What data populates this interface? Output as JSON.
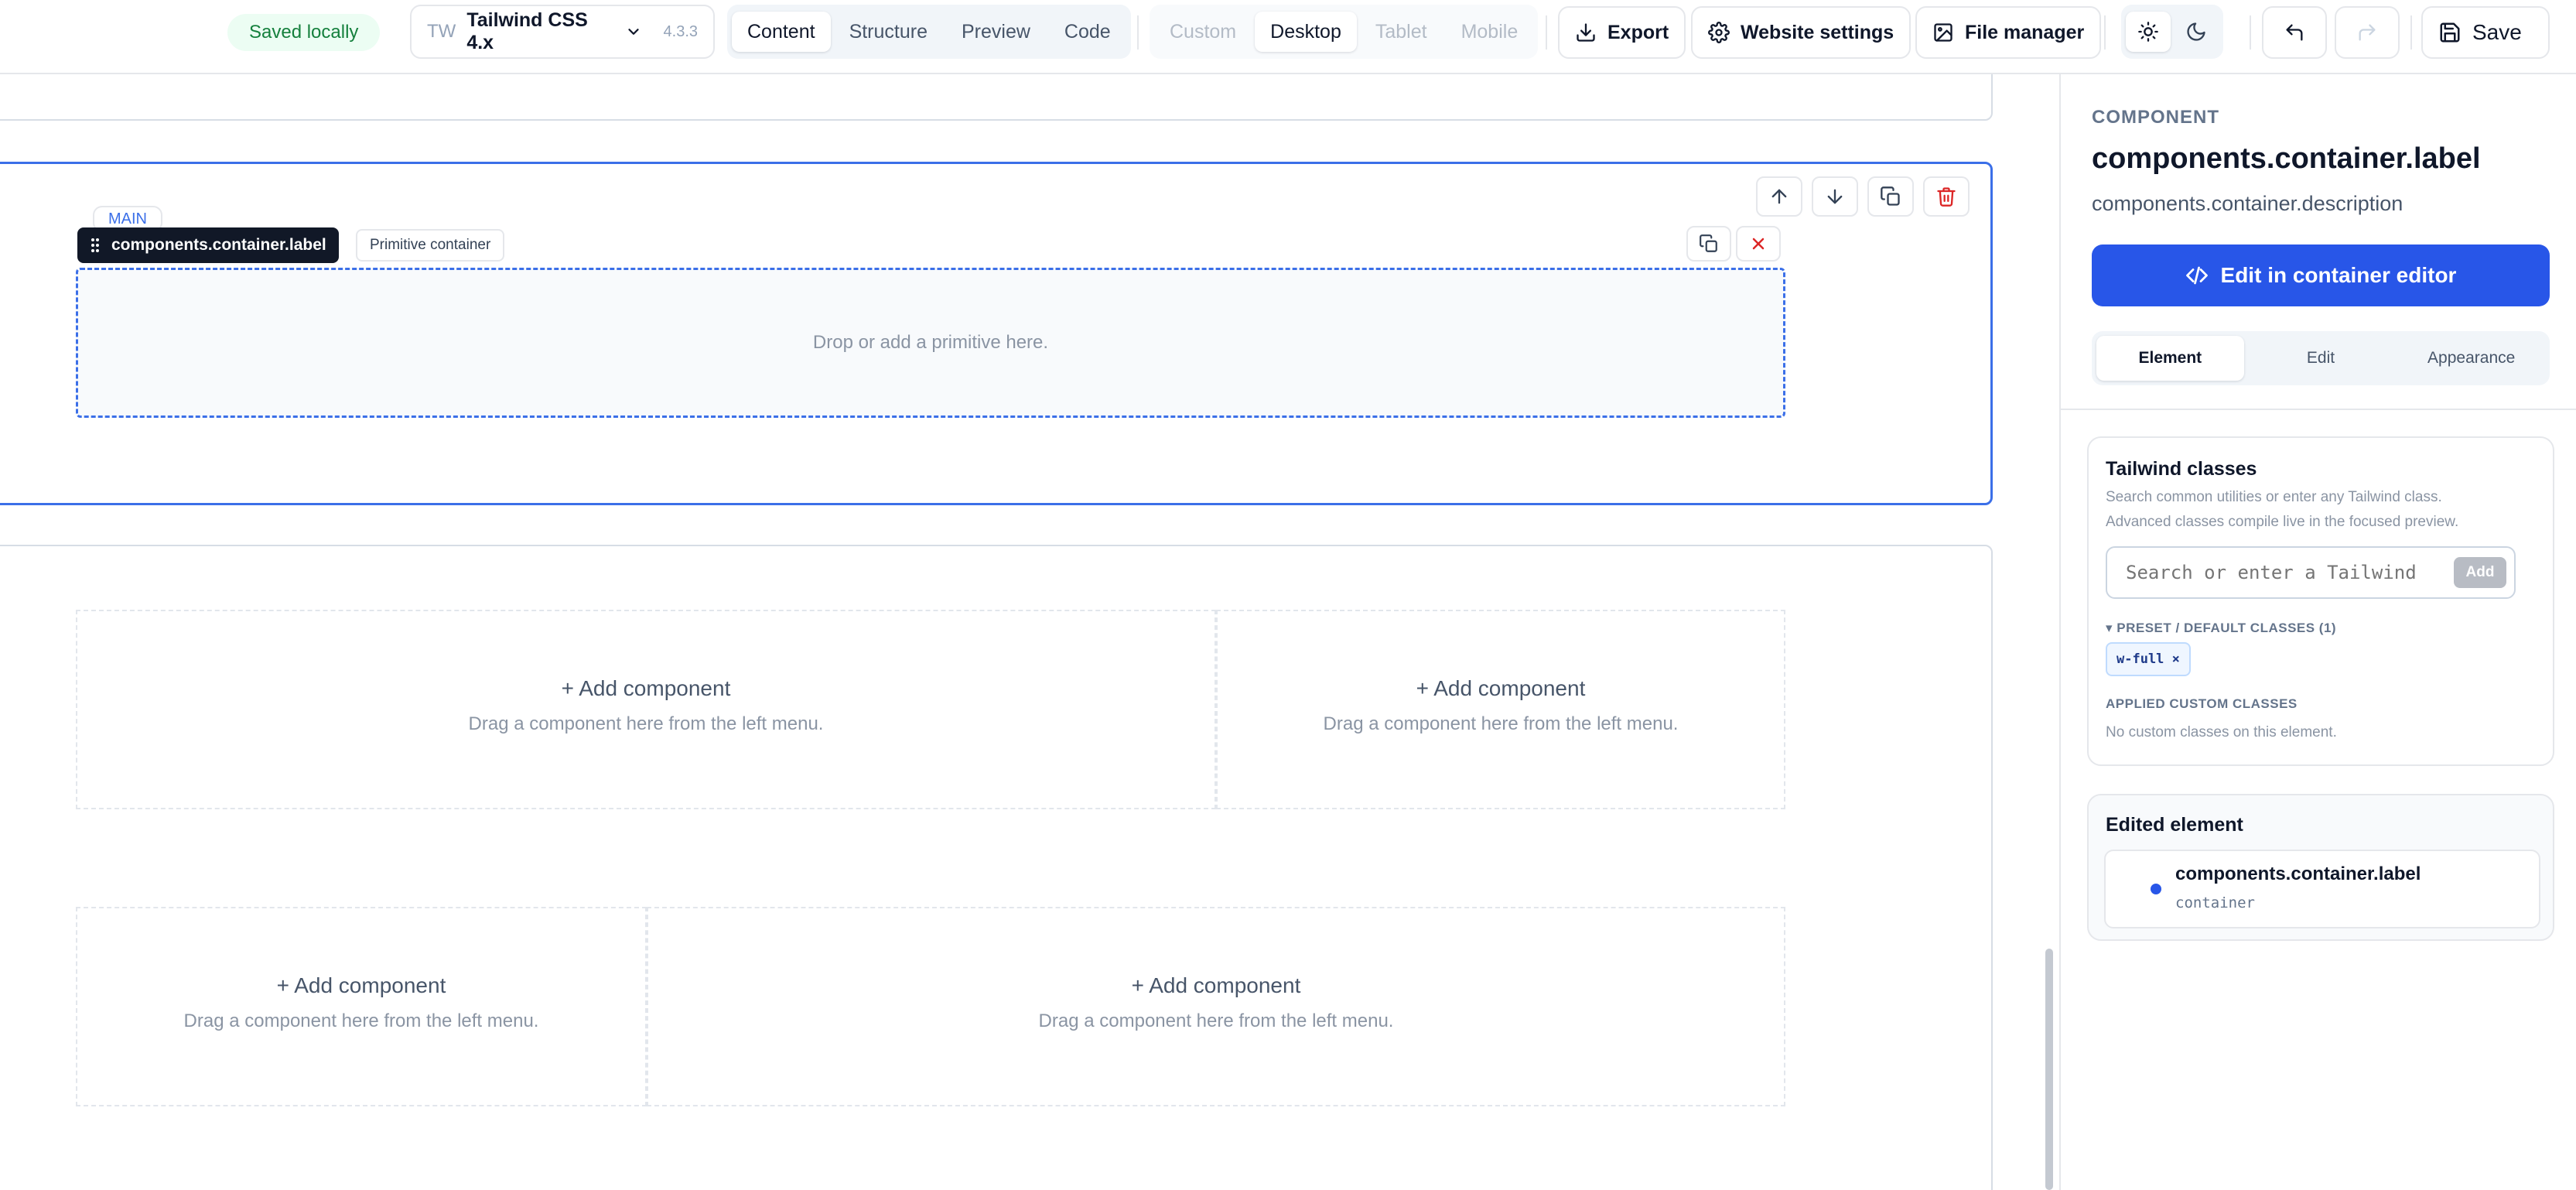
{
  "toolbar": {
    "saved_status": "Saved locally",
    "framework_prefix": "TW",
    "framework_name": "Tailwind CSS 4.x",
    "framework_version": "4.3.3",
    "view_tabs": [
      {
        "label": "Content",
        "active": true
      },
      {
        "label": "Structure",
        "active": false
      },
      {
        "label": "Preview",
        "active": false
      },
      {
        "label": "Code",
        "active": false
      }
    ],
    "device_tabs": [
      {
        "label": "Custom",
        "active": false,
        "disabled": true
      },
      {
        "label": "Desktop",
        "active": true,
        "disabled": false
      },
      {
        "label": "Tablet",
        "active": false,
        "disabled": true
      },
      {
        "label": "Mobile",
        "active": false,
        "disabled": true
      }
    ],
    "export_label": "Export",
    "website_settings_label": "Website settings",
    "file_manager_label": "File manager",
    "save_label": "Save",
    "theme_active": "light"
  },
  "canvas": {
    "section_tag": "MAIN",
    "container_label": "components.container.label",
    "container_type_badge": "Primitive container",
    "drop_hint": "Drop or add a primitive here.",
    "add_component_title": "+ Add component",
    "add_component_hint": "Drag a component here from the left menu."
  },
  "panel": {
    "eyebrow": "COMPONENT",
    "title": "components.container.label",
    "description": "components.container.description",
    "edit_button_label": "Edit in container editor",
    "tabs": [
      {
        "label": "Element",
        "active": true
      },
      {
        "label": "Edit",
        "active": false
      },
      {
        "label": "Appearance",
        "active": false
      }
    ],
    "tailwind": {
      "heading": "Tailwind classes",
      "help_line1": "Search common utilities or enter any Tailwind class.",
      "help_line2": "Advanced classes compile live in the focused preview.",
      "search_placeholder": "Search or enter a Tailwind class",
      "add_label": "Add",
      "preset_heading": "▾ PRESET / DEFAULT CLASSES (1)",
      "preset_classes": [
        "w-full ×"
      ],
      "custom_heading": "APPLIED CUSTOM CLASSES",
      "custom_empty": "No custom classes on this element."
    },
    "edited": {
      "heading": "Edited element",
      "item_name": "components.container.label",
      "item_type": "container"
    }
  },
  "colors": {
    "accent": "#2856e8",
    "selection": "#3b6fe8",
    "saved_bg": "#ecfdf3",
    "saved_text": "#15803d",
    "danger": "#dc2626"
  }
}
